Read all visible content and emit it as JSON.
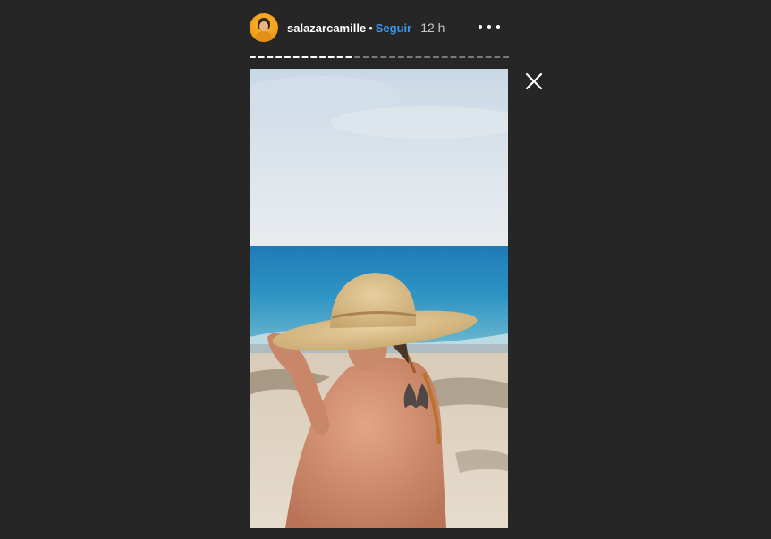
{
  "header": {
    "username": "salazarcamille",
    "separator": "•",
    "follow_label": "Seguir",
    "time": "12 h"
  },
  "icons": {
    "more": "more-options-icon",
    "close": "close-icon"
  },
  "progress": {
    "segments_total": 30,
    "segments_seen": 12
  },
  "colors": {
    "background": "#262626",
    "follow": "#3897f0",
    "avatar_ring": "#f3a21b"
  }
}
